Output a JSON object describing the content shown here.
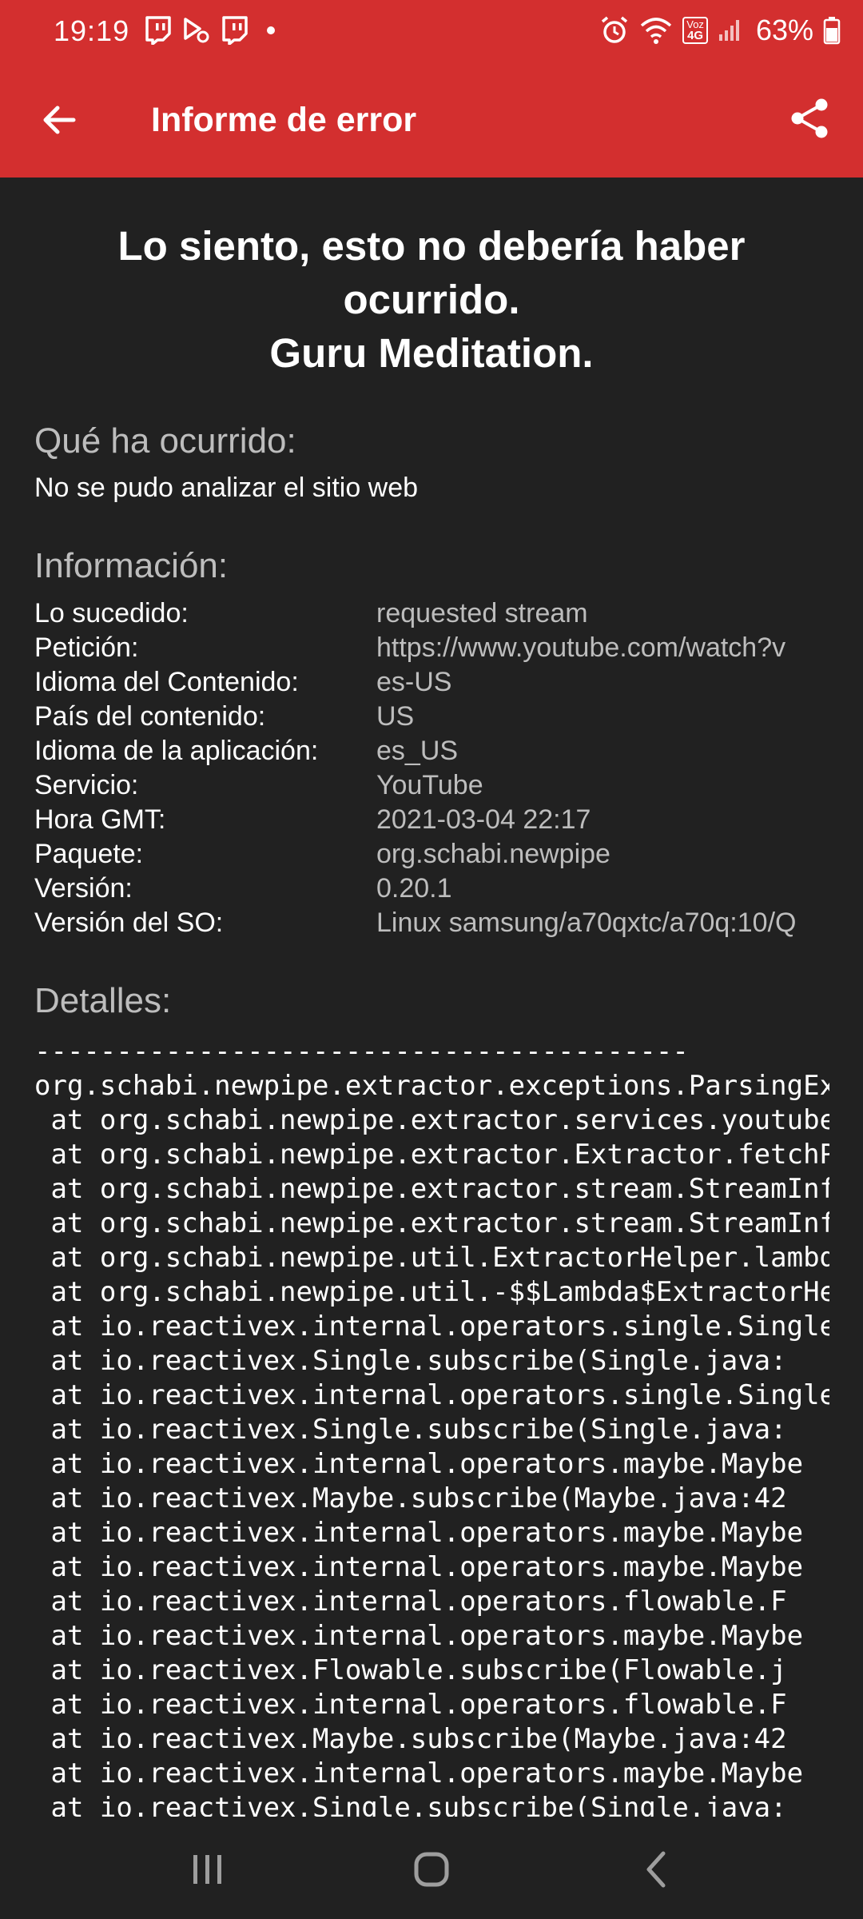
{
  "status_bar": {
    "time": "19:19",
    "battery": "63%",
    "network_label_top": "Voz",
    "network_label_bottom": "4G"
  },
  "app_bar": {
    "title": "Informe de error",
    "back_icon": "arrow-back-icon",
    "share_icon": "share-icon"
  },
  "headline": {
    "line1": "Lo siento, esto no debería haber",
    "line2": "ocurrido.",
    "line3": "Guru Meditation."
  },
  "what_happened": {
    "heading": "Qué ha ocurrido:",
    "text": "No se pudo analizar el sitio web"
  },
  "information": {
    "heading": "Información:",
    "rows": [
      {
        "label": "Lo sucedido:",
        "value": "requested stream"
      },
      {
        "label": "Petición:",
        "value": "https://www.youtube.com/watch?v"
      },
      {
        "label": "Idioma del Contenido:",
        "value": "es-US"
      },
      {
        "label": "País del contenido:",
        "value": "US"
      },
      {
        "label": "Idioma de la aplicación:",
        "value": "es_US"
      },
      {
        "label": "Servicio:",
        "value": "YouTube"
      },
      {
        "label": "Hora GMT:",
        "value": "2021-03-04 22:17"
      },
      {
        "label": "Paquete:",
        "value": "org.schabi.newpipe"
      },
      {
        "label": "Versión:",
        "value": "0.20.1"
      },
      {
        "label": "Versión del SO:",
        "value": "Linux samsung/a70qxtc/a70q:10/Q"
      }
    ]
  },
  "details": {
    "heading": "Detalles:",
    "lines": [
      "----------------------------------------",
      "org.schabi.newpipe.extractor.exceptions.ParsingException",
      " at org.schabi.newpipe.extractor.services.youtube",
      " at org.schabi.newpipe.extractor.Extractor.fetchPage",
      " at org.schabi.newpipe.extractor.stream.StreamInfo",
      " at org.schabi.newpipe.extractor.stream.StreamInfo",
      " at org.schabi.newpipe.util.ExtractorHelper.lambda",
      " at org.schabi.newpipe.util.-$$Lambda$ExtractorHelper",
      " at io.reactivex.internal.operators.single.Single",
      " at io.reactivex.Single.subscribe(Single.java:",
      " at io.reactivex.internal.operators.single.Single",
      " at io.reactivex.Single.subscribe(Single.java:",
      " at io.reactivex.internal.operators.maybe.Maybe",
      " at io.reactivex.Maybe.subscribe(Maybe.java:42",
      " at io.reactivex.internal.operators.maybe.Maybe",
      " at io.reactivex.internal.operators.maybe.Maybe",
      " at io.reactivex.internal.operators.flowable.F",
      " at io.reactivex.internal.operators.maybe.Maybe",
      " at io.reactivex.Flowable.subscribe(Flowable.j",
      " at io.reactivex.internal.operators.flowable.F",
      " at io.reactivex.Maybe.subscribe(Maybe.java:42",
      " at io.reactivex.internal.operators.maybe.Maybe",
      " at io.reactivex.Single.subscribe(Single.java:"
    ]
  },
  "nav_bar": {
    "recents_icon": "recents-icon",
    "home_icon": "home-icon",
    "back_icon": "nav-back-icon"
  },
  "colors": {
    "accent": "#d32f2f",
    "background": "#212121",
    "secondary_text": "#bdbdbd"
  }
}
